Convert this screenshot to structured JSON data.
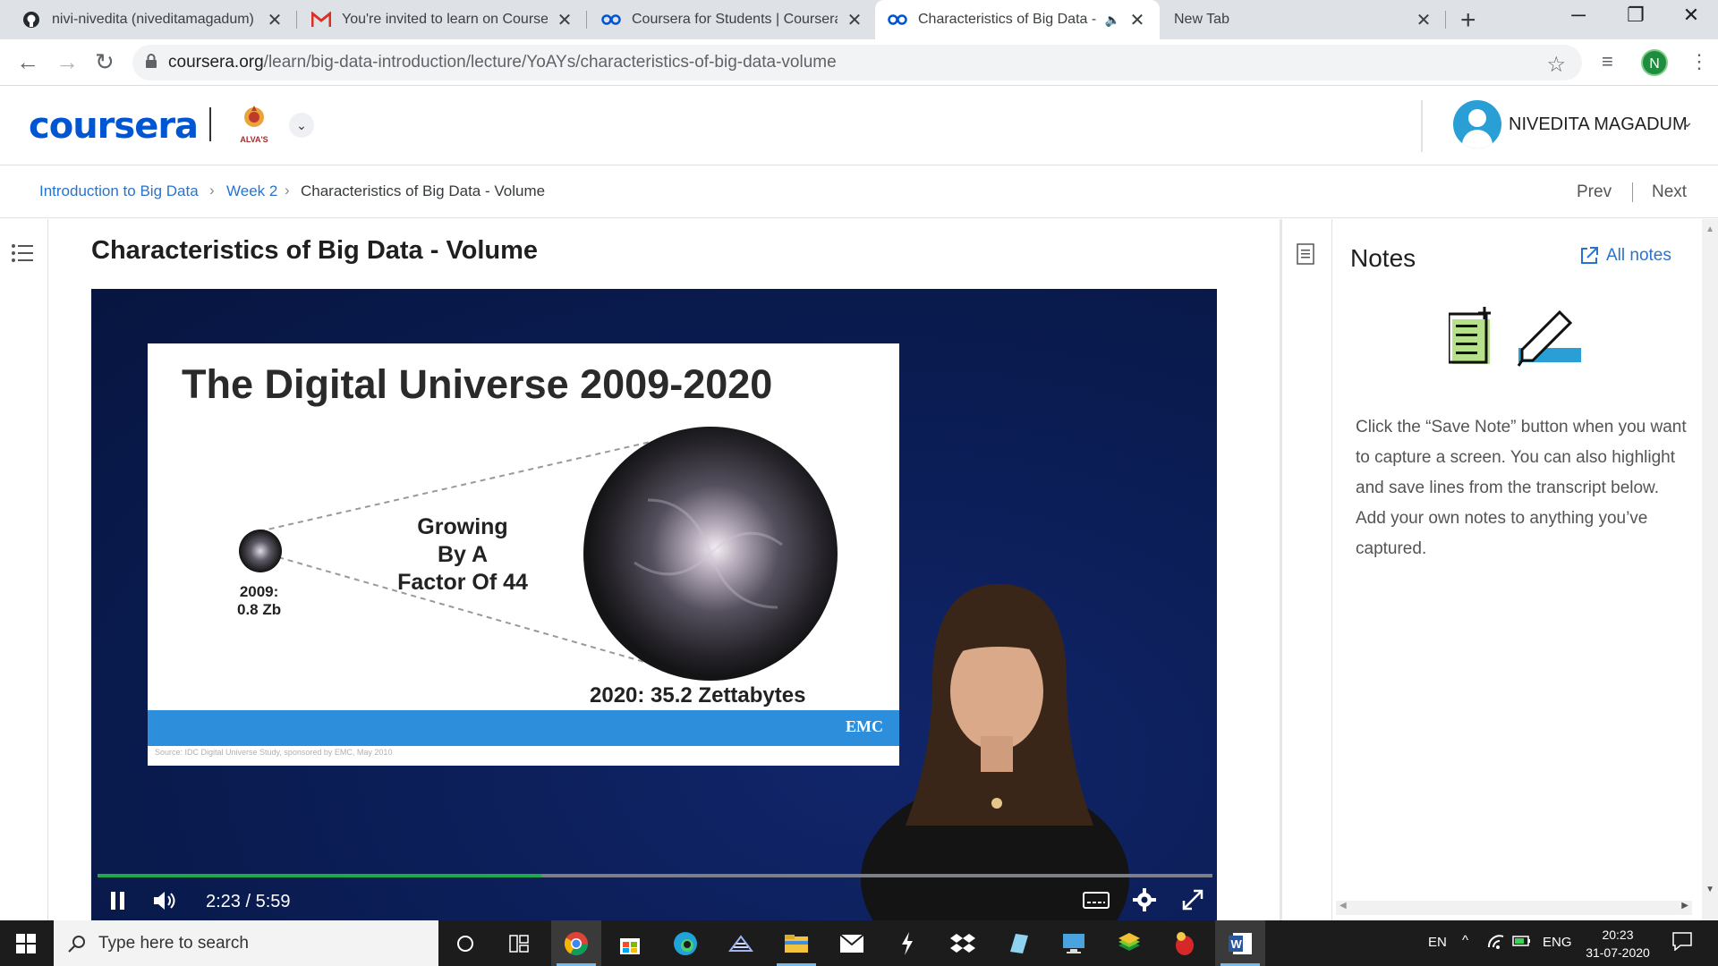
{
  "browser": {
    "tabs": [
      {
        "title": "nivi-nivedita (niveditamagadum)",
        "icon": "github-icon",
        "active": false
      },
      {
        "title": "You're invited to learn on Course",
        "icon": "gmail-icon",
        "active": false
      },
      {
        "title": "Coursera for Students | Coursera",
        "icon": "coursera-icon",
        "active": false
      },
      {
        "title": "Characteristics of Big Data -",
        "icon": "coursera-icon",
        "active": true,
        "audio": true
      },
      {
        "title": "New Tab",
        "icon": "",
        "active": false
      }
    ],
    "url_host": "coursera.org",
    "url_path": "/learn/big-data-introduction/lecture/YoAYs/characteristics-of-big-data-volume",
    "profile_initial": "N"
  },
  "header": {
    "logo": "coursera",
    "org_badge": "ALVA'S",
    "user_name": "NIVEDITA MAGADUM"
  },
  "breadcrumb": {
    "course": "Introduction to Big Data",
    "week": "Week 2",
    "current": "Characteristics of Big Data - Volume",
    "prev": "Prev",
    "next": "Next"
  },
  "lesson": {
    "title": "Characteristics of Big Data - Volume"
  },
  "video": {
    "slide_title": "The Digital Universe 2009-2020",
    "label_2009_line1": "2009:",
    "label_2009_line2": "0.8 Zb",
    "growth_line1": "Growing",
    "growth_line2": "By A",
    "growth_line3": "Factor Of 44",
    "label_2020": "2020: 35.2 Zettabytes",
    "brand": "EMC",
    "source_note": "Source: IDC Digital Universe Study, sponsored by EMC, May 2010",
    "current_time": "2:23",
    "time_sep": "/",
    "duration": "5:59",
    "progress_fraction": 0.398
  },
  "notes": {
    "title": "Notes",
    "all_notes": "All notes",
    "help_text": "Click the “Save Note” button when you want to capture a screen. You can also highlight and save lines from the transcript below. Add your own notes to anything you’ve captured."
  },
  "taskbar": {
    "search_placeholder": "Type here to search",
    "tray_lang": "EN",
    "tray_keyboard": "ENG",
    "time": "20:23",
    "date": "31-07-2020"
  },
  "colors": {
    "coursera_blue": "#0056d2",
    "link_blue": "#2a73cc",
    "progress_green": "#1faa4a",
    "video_bg": "#0a1c52"
  }
}
